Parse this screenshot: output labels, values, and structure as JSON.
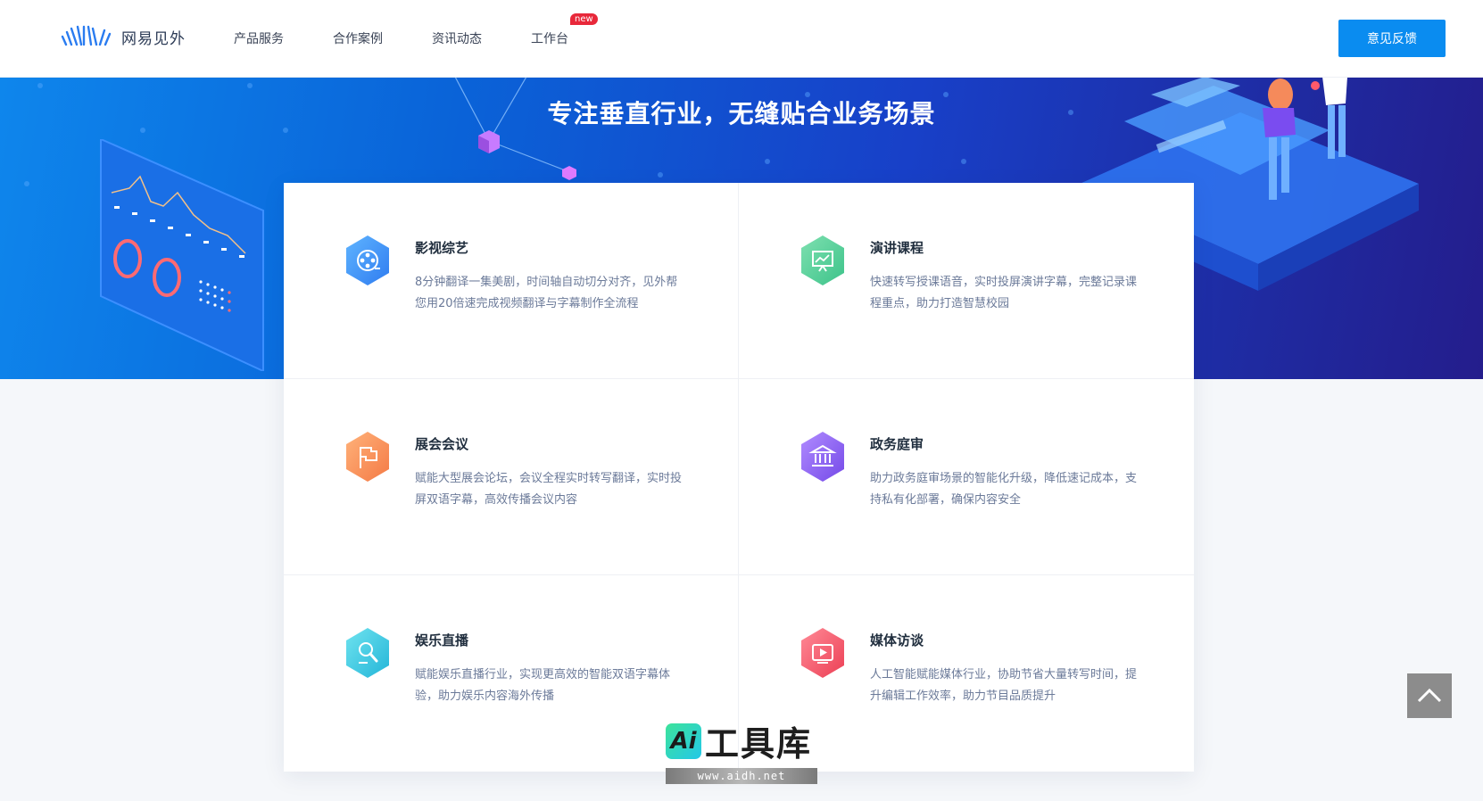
{
  "header": {
    "logo_text": "网易见外",
    "nav": [
      {
        "label": "产品服务"
      },
      {
        "label": "合作案例"
      },
      {
        "label": "资讯动态"
      },
      {
        "label": "工作台",
        "badge": "new"
      }
    ],
    "feedback_label": "意见反馈"
  },
  "banner": {
    "title": "专注垂直行业，无缝贴合业务场景"
  },
  "cards": [
    {
      "title": "影视综艺",
      "desc": "8分钟翻译一集美剧，时间轴自动切分对齐，见外帮您用20倍速完成视频翻译与字幕制作全流程",
      "icon": "film-reel-icon",
      "color_from": "#5fb4ff",
      "color_to": "#2f7cf0"
    },
    {
      "title": "演讲课程",
      "desc": "快速转写授课语音，实时投屏演讲字幕，完整记录课程重点，助力打造智慧校园",
      "icon": "presentation-board-icon",
      "color_from": "#7ee0b0",
      "color_to": "#3dc38a"
    },
    {
      "title": "展会会议",
      "desc": "赋能大型展会论坛，会议全程实时转写翻译，实时投屏双语字幕，高效传播会议内容",
      "icon": "flag-icon",
      "color_from": "#ffb27a",
      "color_to": "#f47a45"
    },
    {
      "title": "政务庭审",
      "desc": "助力政务庭审场景的智能化升级，降低速记成本，支持私有化部署，确保内容安全",
      "icon": "courthouse-icon",
      "color_from": "#b18cff",
      "color_to": "#7449e8"
    },
    {
      "title": "娱乐直播",
      "desc": "赋能娱乐直播行业，实现更高效的智能双语字幕体验，助力娱乐内容海外传播",
      "icon": "microphone-icon",
      "color_from": "#6fe3ef",
      "color_to": "#23b5d8"
    },
    {
      "title": "媒体访谈",
      "desc": "人工智能赋能媒体行业，协助节省大量转写时间，提升编辑工作效率，助力节目品质提升",
      "icon": "video-play-icon",
      "color_from": "#ff8a96",
      "color_to": "#ec3f55"
    }
  ],
  "watermark": {
    "badge": "Ai",
    "text": "工具库",
    "url": "www.aidh.net"
  },
  "colors": {
    "primary": "#0a8cf0",
    "badge_red": "#e8283a"
  }
}
